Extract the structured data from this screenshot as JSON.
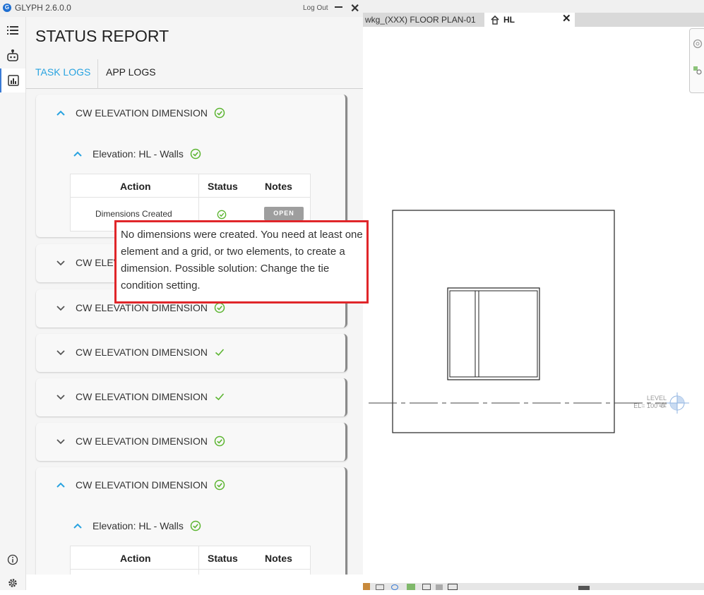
{
  "app": {
    "logo_letter": "G",
    "title": "GLYPH 2.6.0.0",
    "logout_label": "Log Out"
  },
  "rail": {
    "items": [
      {
        "icon": "list-icon"
      },
      {
        "icon": "robot-icon"
      },
      {
        "icon": "report-chart-icon",
        "active": true
      }
    ],
    "bottom": [
      {
        "icon": "info-icon"
      },
      {
        "icon": "gear-icon"
      }
    ]
  },
  "report": {
    "title": "STATUS REPORT",
    "tabs": [
      {
        "label": "TASK LOGS",
        "active": true
      },
      {
        "label": "APP LOGS",
        "active": false
      }
    ],
    "cards": [
      {
        "title": "CW ELEVATION DIMENSION",
        "expanded": true,
        "status": "circle-check",
        "sub": {
          "title": "Elevation: HL - Walls",
          "headers": [
            "Action",
            "Status",
            "Notes"
          ],
          "row": {
            "action": "Dimensions Created",
            "notes_button": "OPEN"
          }
        }
      },
      {
        "title": "CW ELEVATION DIMENSION",
        "expanded": false,
        "status": "circle-check"
      },
      {
        "title": "CW ELEVATION DIMENSION",
        "expanded": false,
        "status": "circle-check"
      },
      {
        "title": "CW ELEVATION DIMENSION",
        "expanded": false,
        "status": "check"
      },
      {
        "title": "CW ELEVATION DIMENSION",
        "expanded": false,
        "status": "check"
      },
      {
        "title": "CW ELEVATION DIMENSION",
        "expanded": false,
        "status": "circle-check"
      },
      {
        "title": "CW ELEVATION DIMENSION",
        "expanded": true,
        "status": "circle-check",
        "sub": {
          "title": "Elevation: HL - Walls",
          "headers": [
            "Action",
            "Status",
            "Notes"
          ]
        }
      }
    ]
  },
  "tooltip": {
    "text": "No dimensions were created. You need at least one element and a grid, or two elements, to create a dimension. Possible solution: Change the tie condition setting."
  },
  "view": {
    "tabs": [
      {
        "label": "wkg_(XXX) FLOOR PLAN-01"
      },
      {
        "label": "HL",
        "active": true
      }
    ],
    "level": {
      "name": "LEVEL 01",
      "elevation": "EL= 100'-0\""
    }
  },
  "colors": {
    "accent": "#29a3e0",
    "success": "#5cb531",
    "highlight": "#e0262a",
    "rail_active": "#3a7bd5"
  }
}
